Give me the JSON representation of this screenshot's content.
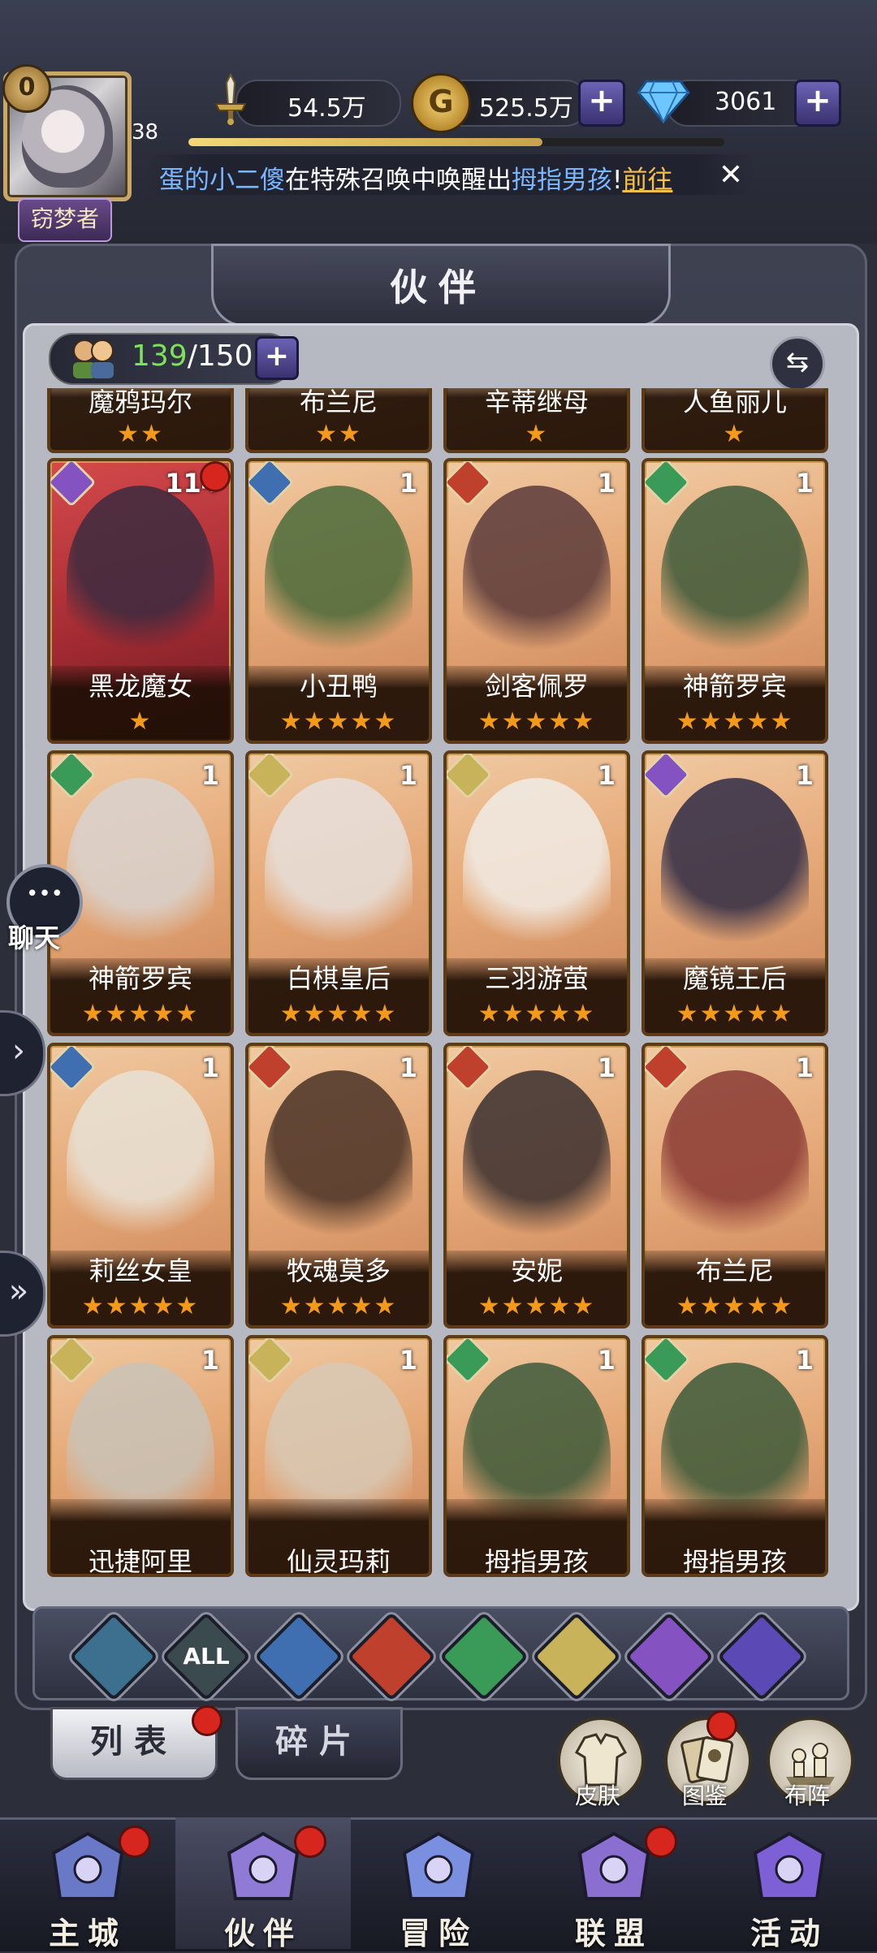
{
  "player": {
    "level": "38",
    "vip": "0",
    "title": "窃梦者"
  },
  "resources": {
    "power": "54.5万",
    "gold": "525.5万",
    "gems": "3061",
    "xp_fraction": 0.66
  },
  "ticker": {
    "player": "蛋的小二傻",
    "mid": "在特殊召唤中唤醒出",
    "hero": "拇指男孩",
    "bang": "!",
    "link": "前往"
  },
  "panel": {
    "title": "伙伴",
    "count_current": "139",
    "count_sep": "/150"
  },
  "top_row": [
    {
      "name": "魔鸦玛尔",
      "stars": "★★"
    },
    {
      "name": "布兰尼",
      "stars": "★★"
    },
    {
      "name": "辛蒂继母",
      "stars": "★"
    },
    {
      "name": "人鱼丽儿",
      "stars": "★"
    }
  ],
  "rows": [
    [
      {
        "name": "黑龙魔女",
        "level": "114",
        "stars": "★",
        "element": "shadow",
        "badge": true
      },
      {
        "name": "小丑鸭",
        "level": "1",
        "stars": "★★★★★",
        "element": "water"
      },
      {
        "name": "剑客佩罗",
        "level": "1",
        "stars": "★★★★★",
        "element": "fire"
      },
      {
        "name": "神箭罗宾",
        "level": "1",
        "stars": "★★★★★",
        "element": "nature"
      }
    ],
    [
      {
        "name": "神箭罗宾",
        "level": "1",
        "stars": "★★★★★",
        "element": "nature"
      },
      {
        "name": "白棋皇后",
        "level": "1",
        "stars": "★★★★★",
        "element": "light"
      },
      {
        "name": "三羽游萤",
        "level": "1",
        "stars": "★★★★★",
        "element": "light"
      },
      {
        "name": "魔镜王后",
        "level": "1",
        "stars": "★★★★★",
        "element": "shadow"
      }
    ],
    [
      {
        "name": "莉丝女皇",
        "level": "1",
        "stars": "★★★★★",
        "element": "water"
      },
      {
        "name": "牧魂莫多",
        "level": "1",
        "stars": "★★★★★",
        "element": "fire"
      },
      {
        "name": "安妮",
        "level": "1",
        "stars": "★★★★★",
        "element": "fire"
      },
      {
        "name": "布兰尼",
        "level": "1",
        "stars": "★★★★★",
        "element": "fire"
      }
    ],
    [
      {
        "name": "迅捷阿里",
        "level": "1",
        "stars": "",
        "element": "light"
      },
      {
        "name": "仙灵玛莉",
        "level": "1",
        "stars": "",
        "element": "light"
      },
      {
        "name": "拇指男孩",
        "level": "1",
        "stars": "",
        "element": "nature"
      },
      {
        "name": "拇指男孩",
        "level": "1",
        "stars": "",
        "element": "nature"
      }
    ]
  ],
  "filters": [
    {
      "id": "neutral",
      "label": "",
      "color": "#3d6f8f"
    },
    {
      "id": "all",
      "label": "ALL",
      "color": "#3b4a4e"
    },
    {
      "id": "water",
      "label": "",
      "color": "#3f6fb0"
    },
    {
      "id": "fire",
      "label": "",
      "color": "#c0402e"
    },
    {
      "id": "nature",
      "label": "",
      "color": "#3a9a58"
    },
    {
      "id": "light",
      "label": "",
      "color": "#c8b35a"
    },
    {
      "id": "shadow",
      "label": "",
      "color": "#8552c2"
    },
    {
      "id": "void",
      "label": "",
      "color": "#5b49b5"
    }
  ],
  "tabs": {
    "list": "列表",
    "fragments": "碎片"
  },
  "side_buttons": {
    "skin": "皮肤",
    "codex": "图鉴",
    "formation": "布阵"
  },
  "chat": {
    "label": "聊天"
  },
  "nav": [
    {
      "label": "主城",
      "dot": true
    },
    {
      "label": "伙伴",
      "dot": true,
      "active": true
    },
    {
      "label": "冒险",
      "dot": false
    },
    {
      "label": "联盟",
      "dot": true
    },
    {
      "label": "活动",
      "dot": false
    }
  ],
  "colors": {
    "element_water": "#3f6fb0",
    "element_fire": "#c0402e",
    "element_nature": "#3a9a58",
    "element_light": "#c8b35a",
    "element_shadow": "#8552c2",
    "star": "#f39a1a",
    "count_green": "#7fe05e",
    "link_gold": "#f5c04a"
  }
}
